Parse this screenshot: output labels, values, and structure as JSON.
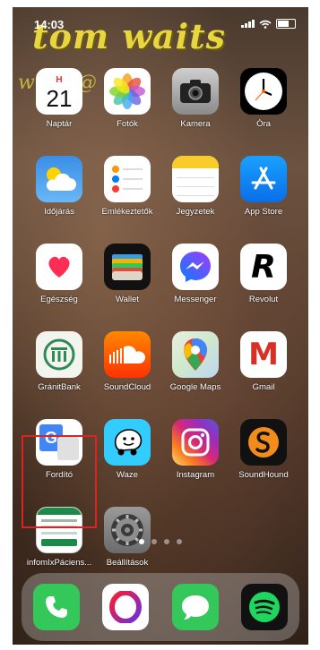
{
  "status_bar": {
    "time": "14:03"
  },
  "wallpaper": {
    "title": "tom waits",
    "subtitle": "with          @"
  },
  "apps": [
    {
      "label": "Naptár",
      "icon": "calendar-icon",
      "day_name": "H",
      "day": "21"
    },
    {
      "label": "Fotók",
      "icon": "photos-icon"
    },
    {
      "label": "Kamera",
      "icon": "camera-icon"
    },
    {
      "label": "Óra",
      "icon": "clock-icon"
    },
    {
      "label": "Időjárás",
      "icon": "weather-icon"
    },
    {
      "label": "Emlékeztetők",
      "icon": "reminders-icon"
    },
    {
      "label": "Jegyzetek",
      "icon": "notes-icon"
    },
    {
      "label": "App Store",
      "icon": "app-store-icon"
    },
    {
      "label": "Egészség",
      "icon": "health-icon"
    },
    {
      "label": "Wallet",
      "icon": "wallet-icon"
    },
    {
      "label": "Messenger",
      "icon": "messenger-icon"
    },
    {
      "label": "Revolut",
      "icon": "revolut-icon",
      "glyph": "R"
    },
    {
      "label": "GránitBank",
      "icon": "granitbank-icon"
    },
    {
      "label": "SoundCloud",
      "icon": "soundcloud-icon"
    },
    {
      "label": "Google Maps",
      "icon": "google-maps-icon"
    },
    {
      "label": "Gmail",
      "icon": "gmail-icon",
      "glyph": "M"
    },
    {
      "label": "Fordító",
      "icon": "translate-icon",
      "glyph": "G"
    },
    {
      "label": "Waze",
      "icon": "waze-icon"
    },
    {
      "label": "Instagram",
      "icon": "instagram-icon"
    },
    {
      "label": "SoundHound",
      "icon": "soundhound-icon"
    },
    {
      "label": "infomIxPáciens...",
      "icon": "infomix-icon"
    },
    {
      "label": "Beállítások",
      "icon": "settings-icon"
    }
  ],
  "dock": [
    {
      "icon": "phone-icon"
    },
    {
      "icon": "opera-icon"
    },
    {
      "icon": "messages-icon"
    },
    {
      "icon": "spotify-icon"
    }
  ],
  "page_indicator": {
    "count": 4,
    "active": 0
  }
}
